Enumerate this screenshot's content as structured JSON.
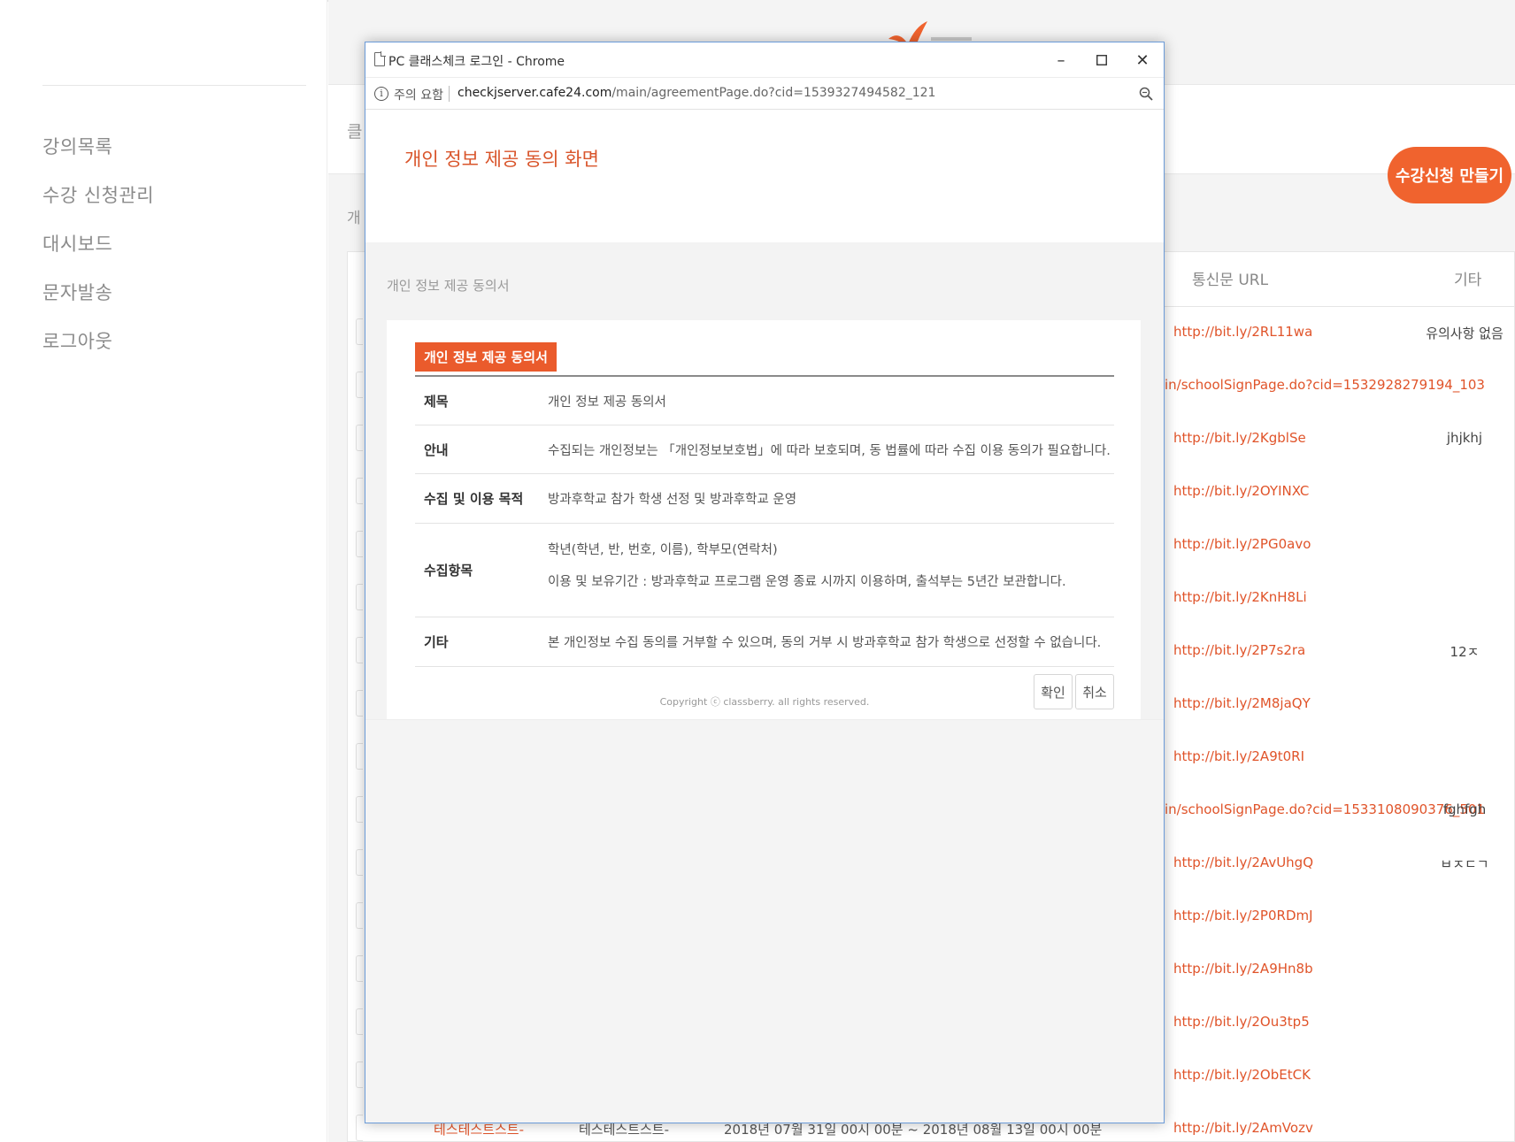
{
  "sidebar": {
    "items": [
      {
        "label": "강의목록"
      },
      {
        "label": "수강 신청관리"
      },
      {
        "label": "대시보드"
      },
      {
        "label": "문자발송"
      },
      {
        "label": "로그아웃"
      }
    ]
  },
  "background": {
    "header_fragment_1": "클",
    "header_fragment_2": "개",
    "create_button": "수강신청 만들기",
    "table": {
      "headers": {
        "url": "통신문 URL",
        "etc": "기타"
      },
      "rows": [
        {
          "url": "http://bit.ly/2RL11wa",
          "etc": "유의사항 없음"
        },
        {
          "url": "in/schoolSignPage.do?cid=1532928279194_103",
          "etc": ""
        },
        {
          "url": "http://bit.ly/2KgblSe",
          "etc": "jhjkhj"
        },
        {
          "url": "http://bit.ly/2OYINXC",
          "etc": ""
        },
        {
          "url": "http://bit.ly/2PG0avo",
          "etc": ""
        },
        {
          "url": "http://bit.ly/2KnH8Li",
          "etc": ""
        },
        {
          "url": "http://bit.ly/2P7s2ra",
          "etc": "12ㅈ"
        },
        {
          "url": "http://bit.ly/2M8jaQY",
          "etc": ""
        },
        {
          "url": "http://bit.ly/2A9t0RI",
          "etc": ""
        },
        {
          "url": "in/schoolSignPage.do?cid=1533108090376_501",
          "etc": "fghfgh"
        },
        {
          "url": "http://bit.ly/2AvUhgQ",
          "etc": "ㅂㅈㄷㄱ"
        },
        {
          "url": "http://bit.ly/2P0RDmJ",
          "etc": ""
        },
        {
          "url": "http://bit.ly/2A9Hn8b",
          "etc": ""
        },
        {
          "url": "http://bit.ly/2Ou3tp5",
          "etc": ""
        },
        {
          "url": "http://bit.ly/2ObEtCK",
          "etc": ""
        },
        {
          "url": "http://bit.ly/2AmVozv",
          "etc": ""
        }
      ],
      "bottom_row": {
        "name": "테스테스트스트-",
        "name2": "테스테스트스트-",
        "period": "2018년 07월 31일 00시 00분 ~ 2018년 08월 13일 00시 00분"
      }
    }
  },
  "popup": {
    "window_title": "PC 클래스체크 로그인 - Chrome",
    "address": {
      "warning": "주의 요함",
      "host": "checkjserver.cafe24.com",
      "path": "/main/agreementPage.do?cid=1539327494582_121"
    },
    "heading": "개인 정보 제공 동의 화면",
    "section_label": "개인 정보 제공 동의서",
    "tag": "개인 정보 제공 동의서",
    "rows": [
      {
        "key": "제목",
        "value": "개인 정보 제공 동의서"
      },
      {
        "key": "안내",
        "value": "수집되는 개인정보는 「개인정보보호법」에 따라 보호되며, 동 법률에 따라 수집 이용 동의가 필요합니다."
      },
      {
        "key": "수집 및 이용 목적",
        "value": "방과후학교 참가 학생 선정 및 방과후학교 운영"
      },
      {
        "key": "수집항목",
        "value": "학년(학년, 반, 번호, 이름), 학부모(연락처)",
        "value2": "이용 및 보유기간 : 방과후학교 프로그램 운영 종료 시까지 이용하며, 출석부는 5년간 보관합니다."
      },
      {
        "key": "기타",
        "value": "본 개인정보 수집 동의를 거부할 수 있으며, 동의 거부 시 방과후학교 참가 학생으로 선정할 수 없습니다."
      }
    ],
    "confirm_label": "확인",
    "cancel_label": "취소",
    "copyright": "Copyright ⓒ classberry. all rights reserved."
  },
  "colors": {
    "accent": "#f0632e",
    "link": "#e0542a",
    "popup_border": "#6b9bd8"
  }
}
